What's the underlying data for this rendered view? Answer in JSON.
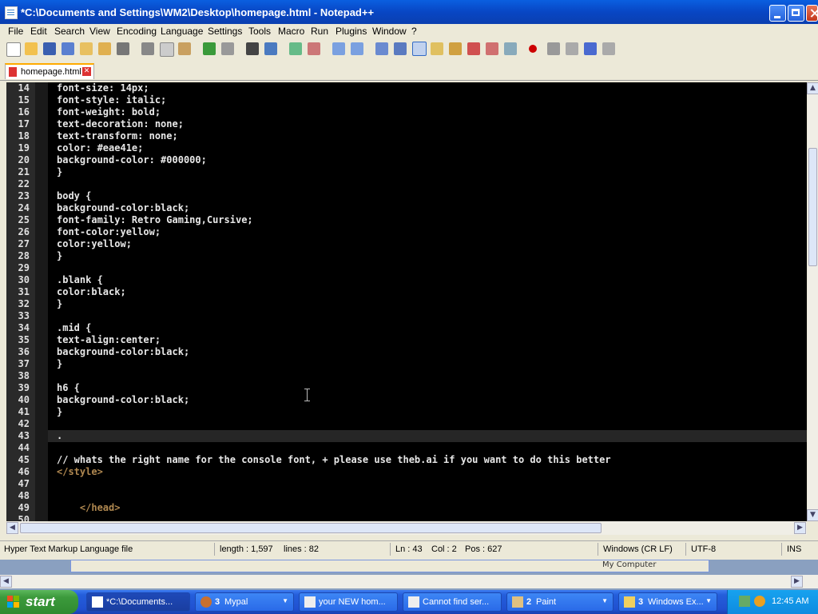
{
  "window": {
    "title": "*C:\\Documents and Settings\\WM2\\Desktop\\homepage.html - Notepad++"
  },
  "menu": [
    "File",
    "Edit",
    "Search",
    "View",
    "Encoding",
    "Language",
    "Settings",
    "Tools",
    "Macro",
    "Run",
    "Plugins",
    "Window",
    "?"
  ],
  "tab": {
    "label": "homepage.html"
  },
  "editor": {
    "lines": [
      {
        "n": "14",
        "text": "font-size: 14px;"
      },
      {
        "n": "15",
        "text": "font-style: italic;"
      },
      {
        "n": "16",
        "text": "font-weight: bold;"
      },
      {
        "n": "17",
        "text": "text-decoration: none;"
      },
      {
        "n": "18",
        "text": "text-transform: none;"
      },
      {
        "n": "19",
        "text": "color: #eae41e;"
      },
      {
        "n": "20",
        "text": "background-color: #000000;"
      },
      {
        "n": "21",
        "text": "}"
      },
      {
        "n": "22",
        "text": ""
      },
      {
        "n": "23",
        "text": "body {"
      },
      {
        "n": "24",
        "text": "background-color:black;"
      },
      {
        "n": "25",
        "text": "font-family: Retro Gaming,Cursive;"
      },
      {
        "n": "26",
        "text": "font-color:yellow;"
      },
      {
        "n": "27",
        "text": "color:yellow;"
      },
      {
        "n": "28",
        "text": "}"
      },
      {
        "n": "29",
        "text": ""
      },
      {
        "n": "30",
        "text": ".blank {"
      },
      {
        "n": "31",
        "text": "color:black;"
      },
      {
        "n": "32",
        "text": "}"
      },
      {
        "n": "33",
        "text": ""
      },
      {
        "n": "34",
        "text": ".mid {"
      },
      {
        "n": "35",
        "text": "text-align:center;"
      },
      {
        "n": "36",
        "text": "background-color:black;"
      },
      {
        "n": "37",
        "text": "}"
      },
      {
        "n": "38",
        "text": ""
      },
      {
        "n": "39",
        "text": "h6 {"
      },
      {
        "n": "40",
        "text": "background-color:black;"
      },
      {
        "n": "41",
        "text": "}"
      },
      {
        "n": "42",
        "text": ""
      },
      {
        "n": "43",
        "text": "."
      },
      {
        "n": "44",
        "text": ""
      },
      {
        "n": "45",
        "text": "// whats the right name for the console font, + please use theb.ai if you want to do this better"
      },
      {
        "n": "46",
        "text": "</style>"
      },
      {
        "n": "47",
        "text": ""
      },
      {
        "n": "48",
        "text": ""
      },
      {
        "n": "49",
        "text": "    </head>"
      },
      {
        "n": "50",
        "text": ""
      }
    ]
  },
  "status": {
    "filetype": "Hyper Text Markup Language file",
    "length": "length : 1,597",
    "lines": "lines : 82",
    "ln": "Ln : 43",
    "col": "Col : 2",
    "pos": "Pos : 627",
    "eol": "Windows (CR LF)",
    "encoding": "UTF-8",
    "mode": "INS"
  },
  "background_window": {
    "text": "My Computer"
  },
  "taskbar": {
    "start": "start",
    "tasks": [
      {
        "count": "",
        "label": "*C:\\Documents...",
        "icon": "notepad-icon",
        "active": true
      },
      {
        "count": "3",
        "label": "Mypal",
        "icon": "mypal-icon"
      },
      {
        "count": "",
        "label": "your NEW hom...",
        "icon": "browser-icon"
      },
      {
        "count": "",
        "label": "Cannot find ser...",
        "icon": "browser-icon"
      },
      {
        "count": "2",
        "label": "Paint",
        "icon": "paint-icon"
      },
      {
        "count": "3",
        "label": "Windows Ex...",
        "icon": "folder-icon"
      }
    ],
    "clock": "12:45 AM"
  },
  "colors": {
    "title_blue": "#0a5fe0",
    "editor_bg": "#000000",
    "tag_color": "#b08850",
    "taskbar_blue": "#245edb",
    "start_green": "#3c9a3c"
  }
}
